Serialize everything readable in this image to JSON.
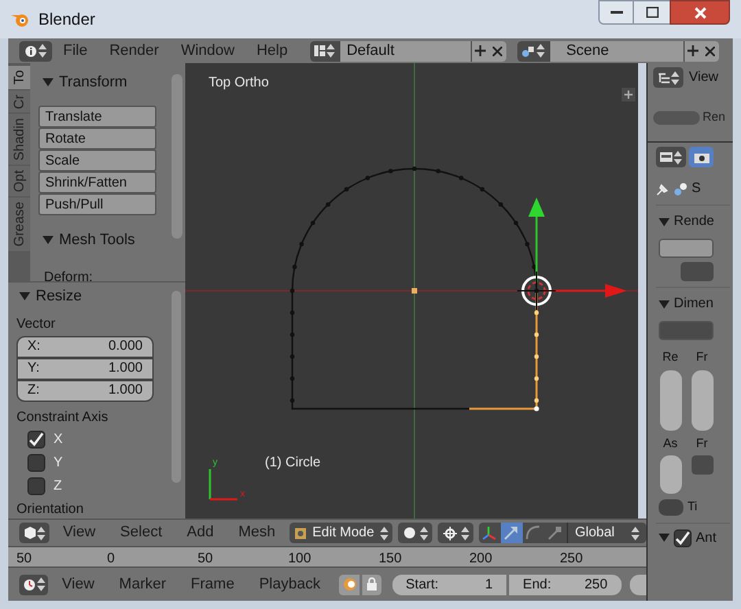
{
  "window": {
    "title": "Blender"
  },
  "menu": [
    "File",
    "Render",
    "Window",
    "Help"
  ],
  "screen_layout": {
    "value": "Default"
  },
  "scene": {
    "value": "Scene"
  },
  "tool_tabs": [
    {
      "label": "To",
      "selected": true
    },
    {
      "label": "Cr",
      "selected": false
    },
    {
      "label": "Shadin",
      "selected": false
    },
    {
      "label": "Opt",
      "selected": false
    },
    {
      "label": "Grease",
      "selected": false
    }
  ],
  "tool_shelf": {
    "panels": [
      {
        "title": "Transform",
        "expanded": true,
        "buttons": [
          "Translate",
          "Rotate",
          "Scale",
          "Shrink/Fatten",
          "Push/Pull"
        ]
      },
      {
        "title": "Mesh Tools",
        "expanded": true,
        "label": "Deform:"
      }
    ]
  },
  "operator_panel": {
    "title": "Resize",
    "expanded": true,
    "vector_label": "Vector",
    "fields": [
      {
        "label": "X:",
        "value": "0.000"
      },
      {
        "label": "Y:",
        "value": "1.000"
      },
      {
        "label": "Z:",
        "value": "1.000"
      }
    ],
    "constraint_label": "Constraint Axis",
    "axes": [
      {
        "label": "X",
        "checked": true
      },
      {
        "label": "Y",
        "checked": false
      },
      {
        "label": "Z",
        "checked": false
      }
    ],
    "orientation_label": "Orientation"
  },
  "viewport": {
    "view_name": "Top Ortho",
    "object_label": "(1) Circle",
    "axis_labels": [
      "y",
      "x"
    ]
  },
  "viewport_header": {
    "menu": [
      "View",
      "Select",
      "Add",
      "Mesh"
    ],
    "mode": "Edit Mode",
    "manipulators": [
      {
        "kind": "axes",
        "selected": false
      },
      {
        "kind": "translate",
        "selected": true
      },
      {
        "kind": "rotate",
        "selected": false
      },
      {
        "kind": "scale",
        "selected": false
      }
    ],
    "orientation": "Global"
  },
  "timeline_ruler": [
    "50",
    "0",
    "50",
    "100",
    "150",
    "200",
    "250"
  ],
  "timeline_header": {
    "menu": [
      "View",
      "Marker",
      "Frame",
      "Playback"
    ],
    "start_label": "Start:",
    "start": "1",
    "end_label": "End:",
    "end": "250"
  },
  "outliner": {
    "view_menu": "View",
    "filter_label": "Ren"
  },
  "properties": {
    "context_label": "S",
    "panels": [
      {
        "title": "Rende",
        "expanded": true
      },
      {
        "title": "Dimen",
        "expanded": true
      }
    ],
    "resolution_labels": [
      "Re",
      "Fr"
    ],
    "aspect_labels": [
      "As",
      "Fr"
    ],
    "time_label": "Ti",
    "anti_aliasing": {
      "label": "Ant",
      "checked": true,
      "expanded": true
    }
  }
}
